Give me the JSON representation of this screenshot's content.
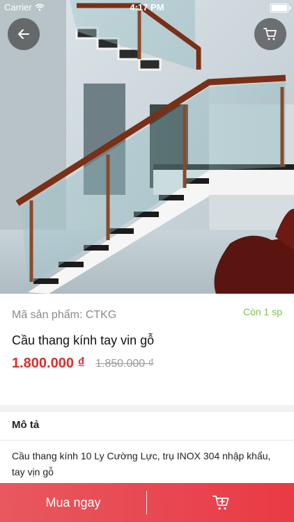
{
  "status_bar": {
    "carrier": "Carrier",
    "time": "4:17 PM"
  },
  "product": {
    "code_label": "Mã sản phẩm: CTKG",
    "stock": "Còn 1 sp",
    "name": "Cầu thang kính tay vin gỗ",
    "price": "1.800.000 ₫",
    "old_price": "1.850.000 ₫"
  },
  "description": {
    "heading": "Mô tả",
    "text": "Cầu thang kính 10 Ly Cường Lực, trụ INOX 304 nhập khẩu, tay vịn gỗ"
  },
  "bottom_bar": {
    "buy_now": "Mua ngay"
  },
  "icons": {
    "back": "arrow-left-icon",
    "cart": "cart-icon",
    "add_to_cart": "cart-plus-icon",
    "wifi": "wifi-icon",
    "battery": "battery-icon"
  },
  "colors": {
    "accent_red": "#e32b2b",
    "stock_green": "#7cc34e",
    "bar_red": "#e93a46"
  }
}
